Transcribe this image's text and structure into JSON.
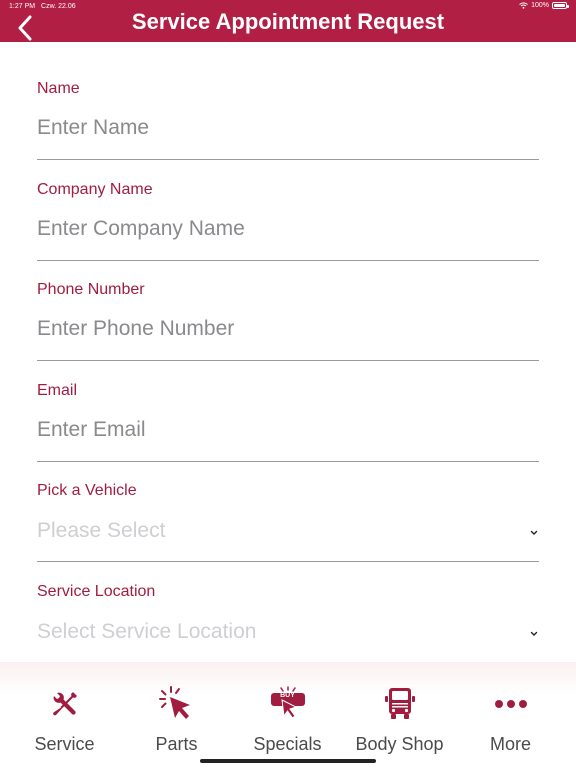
{
  "status_bar": {
    "time": "1:27 PM",
    "date": "Czw. 22.06",
    "battery": "100%"
  },
  "header": {
    "title": "Service Appointment Request"
  },
  "form": {
    "fields": [
      {
        "label": "Name",
        "placeholder": "Enter Name",
        "value": ""
      },
      {
        "label": "Company Name",
        "placeholder": "Enter Company Name",
        "value": ""
      },
      {
        "label": "Phone Number",
        "placeholder": "Enter Phone Number",
        "value": ""
      },
      {
        "label": "Email",
        "placeholder": "Enter Email",
        "value": ""
      }
    ],
    "selects": [
      {
        "label": "Pick a Vehicle",
        "selected": "Please Select"
      },
      {
        "label": "Service Location",
        "selected": "Select Service Location"
      }
    ]
  },
  "tabbar": {
    "tabs": [
      {
        "label": "Service",
        "icon": "wrench-screwdriver-icon"
      },
      {
        "label": "Parts",
        "icon": "cursor-click-icon"
      },
      {
        "label": "Specials",
        "icon": "buy-tag-icon",
        "badge": "BUY"
      },
      {
        "label": "Body Shop",
        "icon": "truck-icon"
      },
      {
        "label": "More",
        "icon": "more-dots-icon"
      }
    ]
  },
  "colors": {
    "brand": "#b21f45",
    "label": "#a11d40",
    "placeholder": "#8a8a8e",
    "select_placeholder": "#cfcfd3",
    "tab_text": "#4b4b4b"
  }
}
